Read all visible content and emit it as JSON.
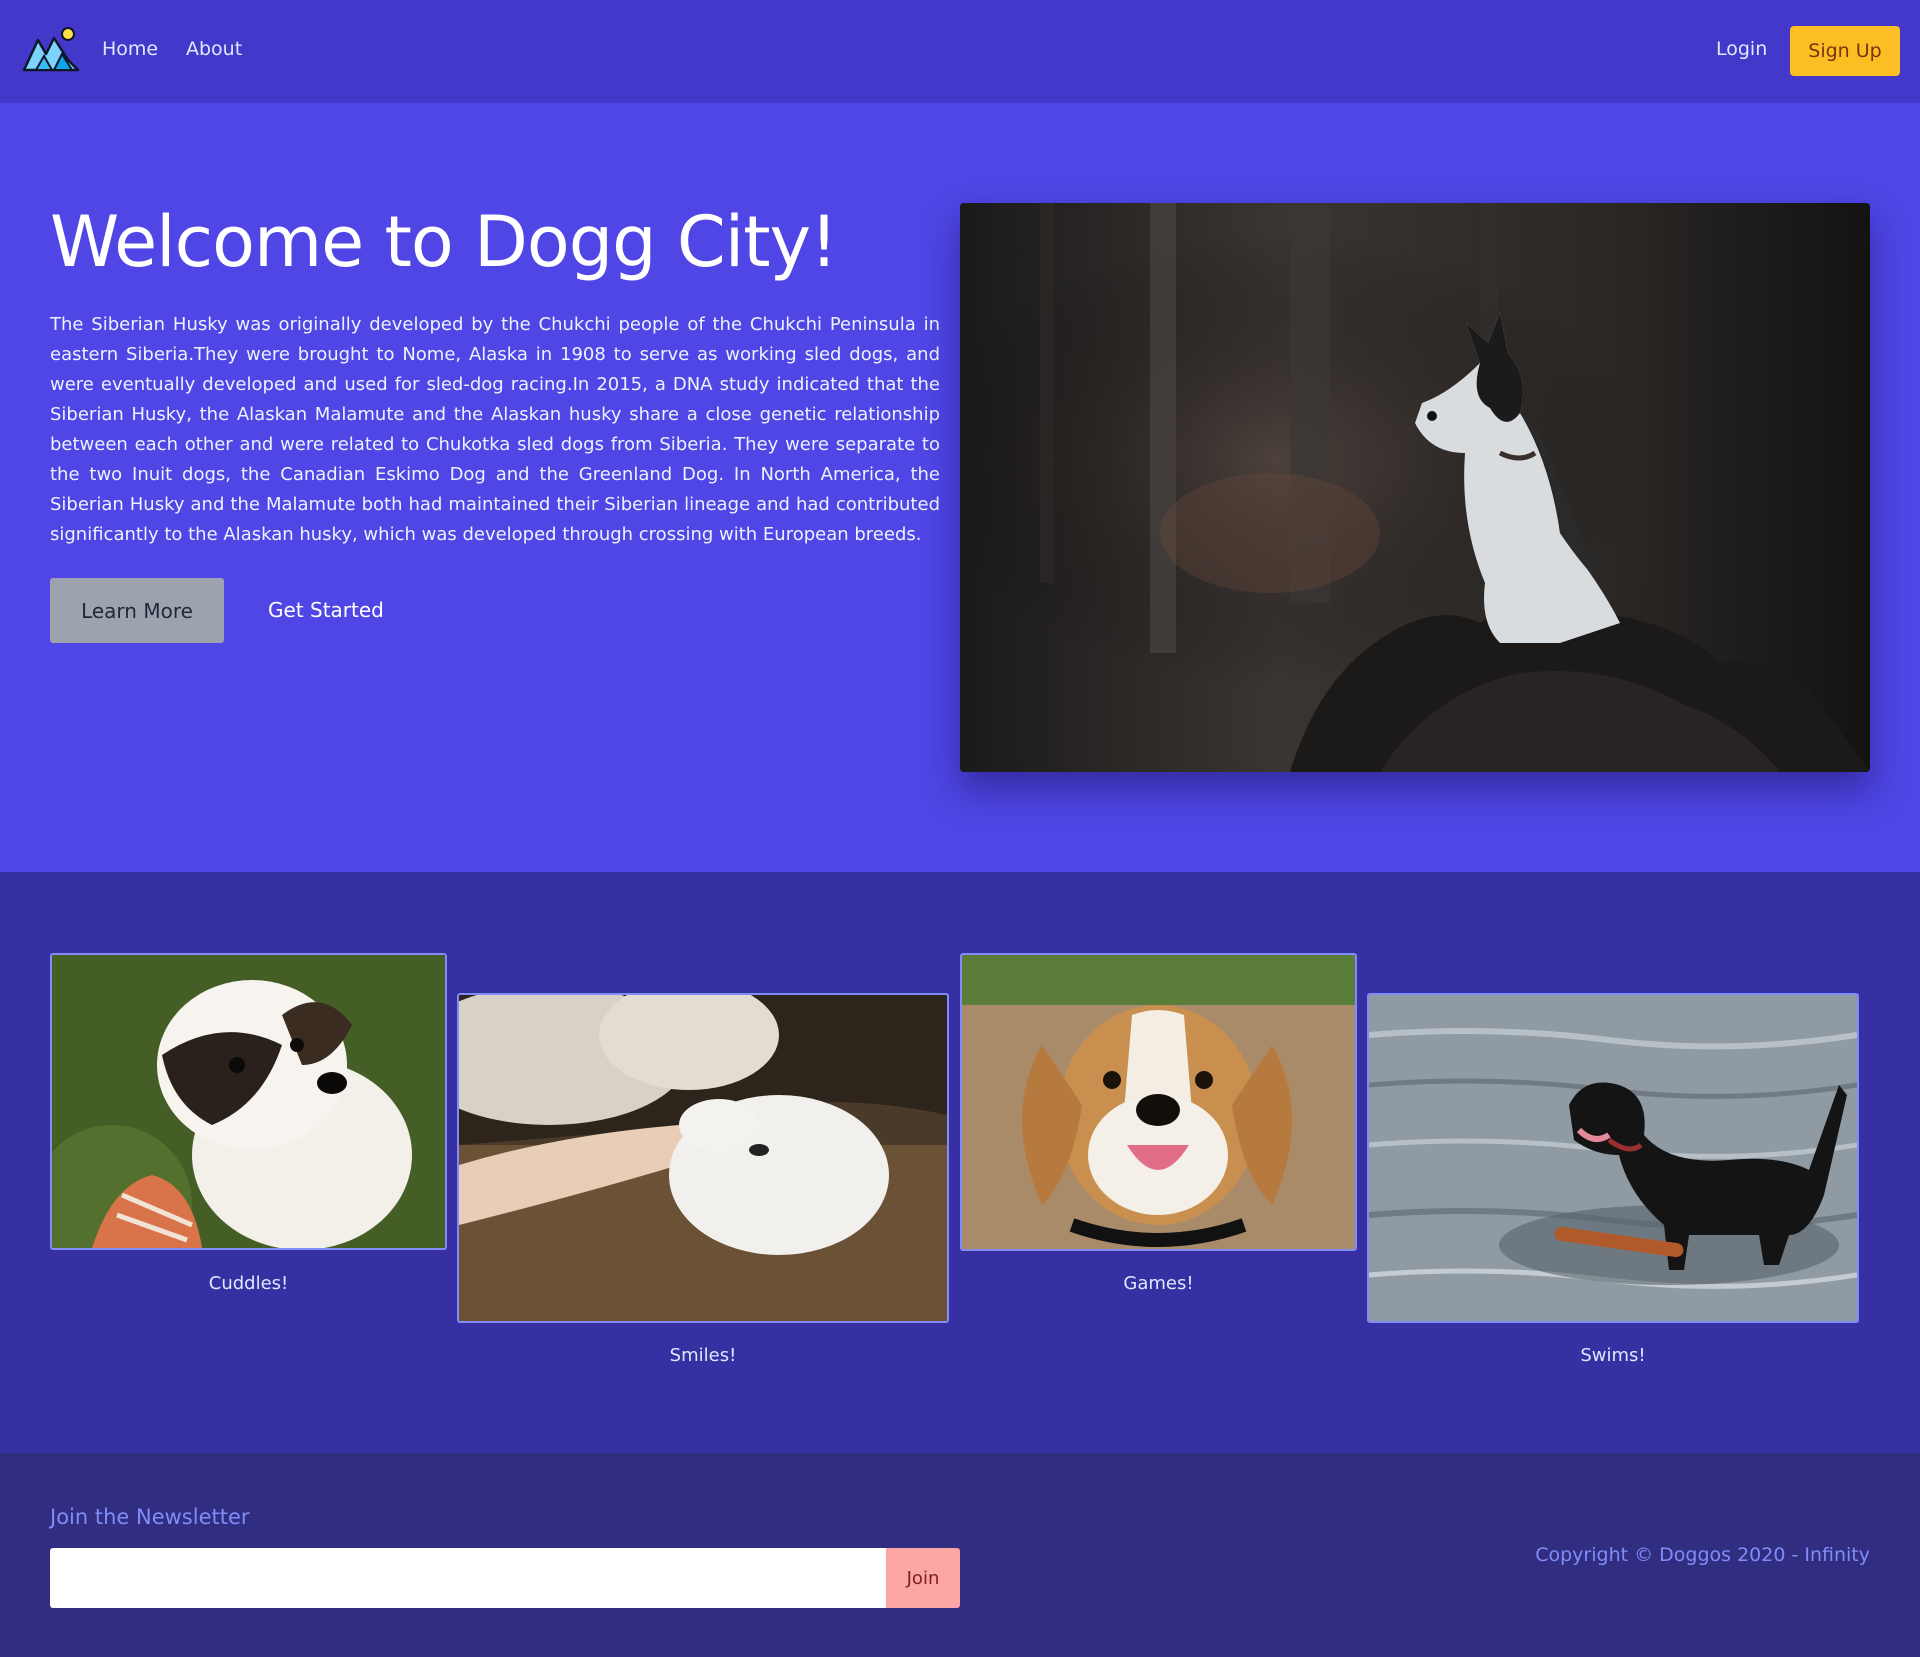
{
  "nav": {
    "logo_icon": "mountain-sun-logo",
    "links": [
      {
        "label": "Home"
      },
      {
        "label": "About"
      }
    ],
    "login_label": "Login",
    "signup_label": "Sign Up"
  },
  "hero": {
    "title": "Welcome to Dogg City!",
    "text": "The Siberian Husky was originally developed by the Chukchi people of the Chukchi Peninsula in eastern Siberia.They were brought to Nome, Alaska in 1908 to serve as working sled dogs, and were eventually developed and used for sled-dog racing.In 2015, a DNA study indicated that the Siberian Husky, the Alaskan Malamute and the Alaskan husky share a close genetic relationship between each other and were related to Chukotka sled dogs from Siberia. They were separate to the two Inuit dogs, the Canadian Eskimo Dog and the Greenland Dog. In North America, the Siberian Husky and the Malamute both had maintained their Siberian lineage and had contributed significantly to the Alaskan husky, which was developed through crossing with European breeds.",
    "learn_more_label": "Learn More",
    "get_started_label": "Get Started"
  },
  "gallery": {
    "items": [
      {
        "caption": "Cuddles!"
      },
      {
        "caption": "Smiles!"
      },
      {
        "caption": "Games!"
      },
      {
        "caption": "Swims!"
      }
    ]
  },
  "footer": {
    "newsletter_title": "Join the Newsletter",
    "input_value": "",
    "join_label": "Join",
    "copyright": "Copyright © Doggos 2020 - Infinity"
  },
  "colors": {
    "nav_bg": "#4338ca",
    "hero_bg": "#4f46e5",
    "gallery_bg": "#3730a3",
    "footer_bg": "#312e81",
    "signup_bg": "#fbbf24",
    "join_bg": "#fca5a5",
    "accent_text": "#818cf8"
  }
}
